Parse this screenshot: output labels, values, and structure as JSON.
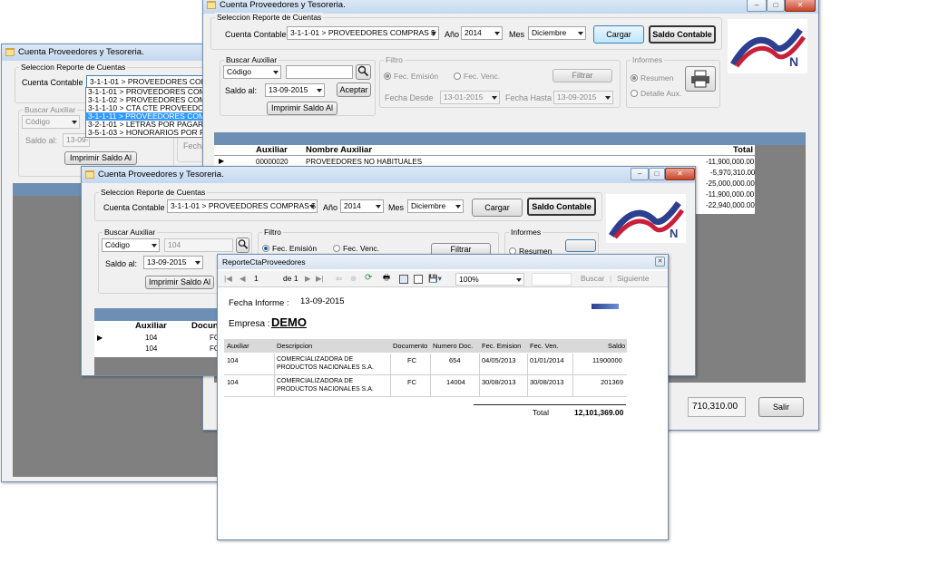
{
  "win_back": {
    "title": "Cuenta Proveedores y Tesoreria.",
    "group_title": "Seleccion Reporte de Cuentas",
    "cuenta_label": "Cuenta Contable",
    "cuenta_value": "3-1-1-01 > PROVEEDORES COMPRA",
    "dropdown_items": [
      "3-1-1-01 > PROVEEDORES COMPRA",
      "3-1-1-02 > PROVEEDORES COMPRA",
      "3-1-1-10 > CTA CTE PROVEEDORES",
      "3-1-1-11 > PROVEEDORES COMPRA",
      "3-2-1-01 > LETRAS POR PAGAR",
      "3-5-1-03 > HONORARIOS POR PAGA"
    ],
    "buscar_label": "Buscar Auxiliar",
    "codigo": "Código",
    "saldo_label": "Saldo al:",
    "saldo_value": "13-09-",
    "fecha_label": "Fecha",
    "imprimir": "Imprimir Saldo Al"
  },
  "win_main": {
    "title": "Cuenta Proveedores y Tesoreria.",
    "group_title": "Seleccion Reporte de Cuentas",
    "cuenta_label": "Cuenta Contable",
    "cuenta_value": "3-1-1-01 > PROVEEDORES COMPRAS $",
    "anio_label": "Año",
    "anio_value": "2014",
    "mes_label": "Mes",
    "mes_value": "Diciembre",
    "cargar": "Cargar",
    "saldo_contable": "Saldo Contable",
    "buscar_title": "Buscar Auxiliar",
    "codigo": "Código",
    "saldo_label": "Saldo al:",
    "saldo_value": "13-09-2015",
    "aceptar": "Aceptar",
    "imprimir": "Imprimir Saldo Al",
    "filtro_title": "Filtro",
    "fec_emision": "Fec. Emisión",
    "fec_venc": "Fec. Venc.",
    "filtrar": "Filtrar",
    "fecha_desde_label": "Fecha Desde",
    "fecha_desde": "13-01-2015",
    "fecha_hasta_label": "Fecha Hasta",
    "fecha_hasta": "13-09-2015",
    "informes_title": "Informes",
    "resumen": "Resumen",
    "detalle": "Detalle Aux.",
    "grid_headers": {
      "auxiliar": "Auxiliar",
      "nombre": "Nombre Auxiliar",
      "total": "Total"
    },
    "grid_row": {
      "auxiliar": "00000020",
      "nombre": "PROVEEDORES NO HABITUALES"
    },
    "totals": [
      "-11,900,000.00",
      "-5,970,310.00",
      "-25,000,000.00",
      "-11,900,000.00",
      "-22,940,000.00"
    ],
    "total_box": "710,310.00",
    "salir": "Salir"
  },
  "win_front": {
    "title": "Cuenta Proveedores y Tesoreria.",
    "group_title": "Seleccion Reporte de Cuentas",
    "cuenta_label": "Cuenta Contable",
    "cuenta_value": "3-1-1-01 > PROVEEDORES COMPRAS $",
    "anio_label": "Año",
    "anio_value": "2014",
    "mes_label": "Mes",
    "mes_value": "Diciembre",
    "cargar": "Cargar",
    "saldo_contable": "Saldo Contable",
    "buscar_title": "Buscar Auxiliar",
    "codigo": "Código",
    "buscar_value": "104",
    "saldo_label": "Saldo al:",
    "saldo_value": "13-09-2015",
    "imprimir": "Imprimir Saldo Al",
    "filtro_title": "Filtro",
    "fec_emision": "Fec. Emisión",
    "fec_venc": "Fec. Venc.",
    "filtrar": "Filtrar",
    "informes_title": "Informes",
    "resumen": "Resumen",
    "grid_headers": {
      "auxiliar": "Auxiliar",
      "documento": "Docun"
    },
    "grid_rows": [
      {
        "auxiliar": "104",
        "doc": "FC"
      },
      {
        "auxiliar": "104",
        "doc": "FC"
      }
    ]
  },
  "report": {
    "title": "ReporteCtaProveedores",
    "toolbar": {
      "page": "1",
      "of_label": "de 1",
      "zoom": "100%",
      "buscar": "Buscar",
      "sep": "|",
      "siguiente": "Siguiente"
    },
    "fecha_label": "Fecha Informe :",
    "fecha_value": "13-09-2015",
    "empresa_label": "Empresa :",
    "empresa_value": "DEMO",
    "columns": [
      "Auxiliar",
      "Descripcion",
      "Documento",
      "Numero Doc.",
      "Fec. Emision",
      "Fec. Ven.",
      "Saldo"
    ],
    "rows": [
      {
        "aux": "104",
        "desc1": "COMERCIALIZADORA DE",
        "desc2": "PRODUCTOS NACIONALES S.A.",
        "doc": "FC",
        "num": "654",
        "emision": "04/05/2013",
        "ven": "01/01/2014",
        "saldo": "11900000"
      },
      {
        "aux": "104",
        "desc1": "COMERCIALIZADORA DE",
        "desc2": "PRODUCTOS NACIONALES S.A.",
        "doc": "FC",
        "num": "14004",
        "emision": "30/08/2013",
        "ven": "30/08/2013",
        "saldo": "201369"
      }
    ],
    "total_label": "Total",
    "total_value": "12,101,369.00"
  },
  "colors": {
    "accent": "#3399ff",
    "grid_dark": "#6d8fb3",
    "gray": "#808080"
  }
}
